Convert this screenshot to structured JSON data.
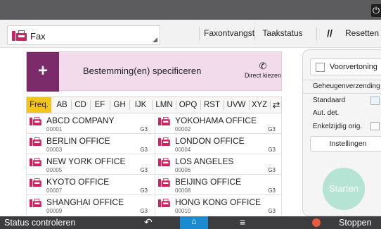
{
  "header": {
    "mode_select": "Fax",
    "buttons": [
      "Faxontvangst",
      "Taakstatus",
      "Resetten"
    ]
  },
  "destination": {
    "label": "Bestemming(en) specificeren",
    "direct_dial": "Direct kiezen"
  },
  "tabs": [
    "Freq.",
    "AB",
    "CD",
    "EF",
    "GH",
    "IJK",
    "LMN",
    "OPQ",
    "RST",
    "UVW",
    "XYZ"
  ],
  "entries": [
    {
      "name": "ABCD COMPANY",
      "num": "00001",
      "mode": "G3"
    },
    {
      "name": "YOKOHAMA OFFICE",
      "num": "00002",
      "mode": "G3"
    },
    {
      "name": "BERLIN OFFICE",
      "num": "00003",
      "mode": "G3"
    },
    {
      "name": "LONDON OFFICE",
      "num": "00004",
      "mode": "G3"
    },
    {
      "name": "NEW YORK OFFICE",
      "num": "00005",
      "mode": "G3"
    },
    {
      "name": "LOS ANGELES",
      "num": "00006",
      "mode": "G3"
    },
    {
      "name": "KYOTO OFFICE",
      "num": "00007",
      "mode": "G3"
    },
    {
      "name": "BEIJING OFFICE",
      "num": "00008",
      "mode": "G3"
    },
    {
      "name": "SHANGHAI  OFFICE",
      "num": "00009",
      "mode": "G3"
    },
    {
      "name": "HONG KONG OFFICE",
      "num": "00010",
      "mode": "G3"
    }
  ],
  "right_panel": {
    "preview": "Voorvertoning",
    "memory_send": "Geheugenverzending",
    "standard": "Standaard",
    "aut_det": "Aut. det.",
    "single_sided": "Enkelzijdig orig.",
    "settings": "Instellingen",
    "start": "Starten"
  },
  "bottom": {
    "status": "Status controleren",
    "stop": "Stoppen"
  },
  "colors": {
    "accent_fax": "#d0225f",
    "plus_button": "#7b2a6a",
    "active_tab": "#f3c51b",
    "start_button": "#b6e4d4",
    "home_button": "#1a8bd0"
  }
}
